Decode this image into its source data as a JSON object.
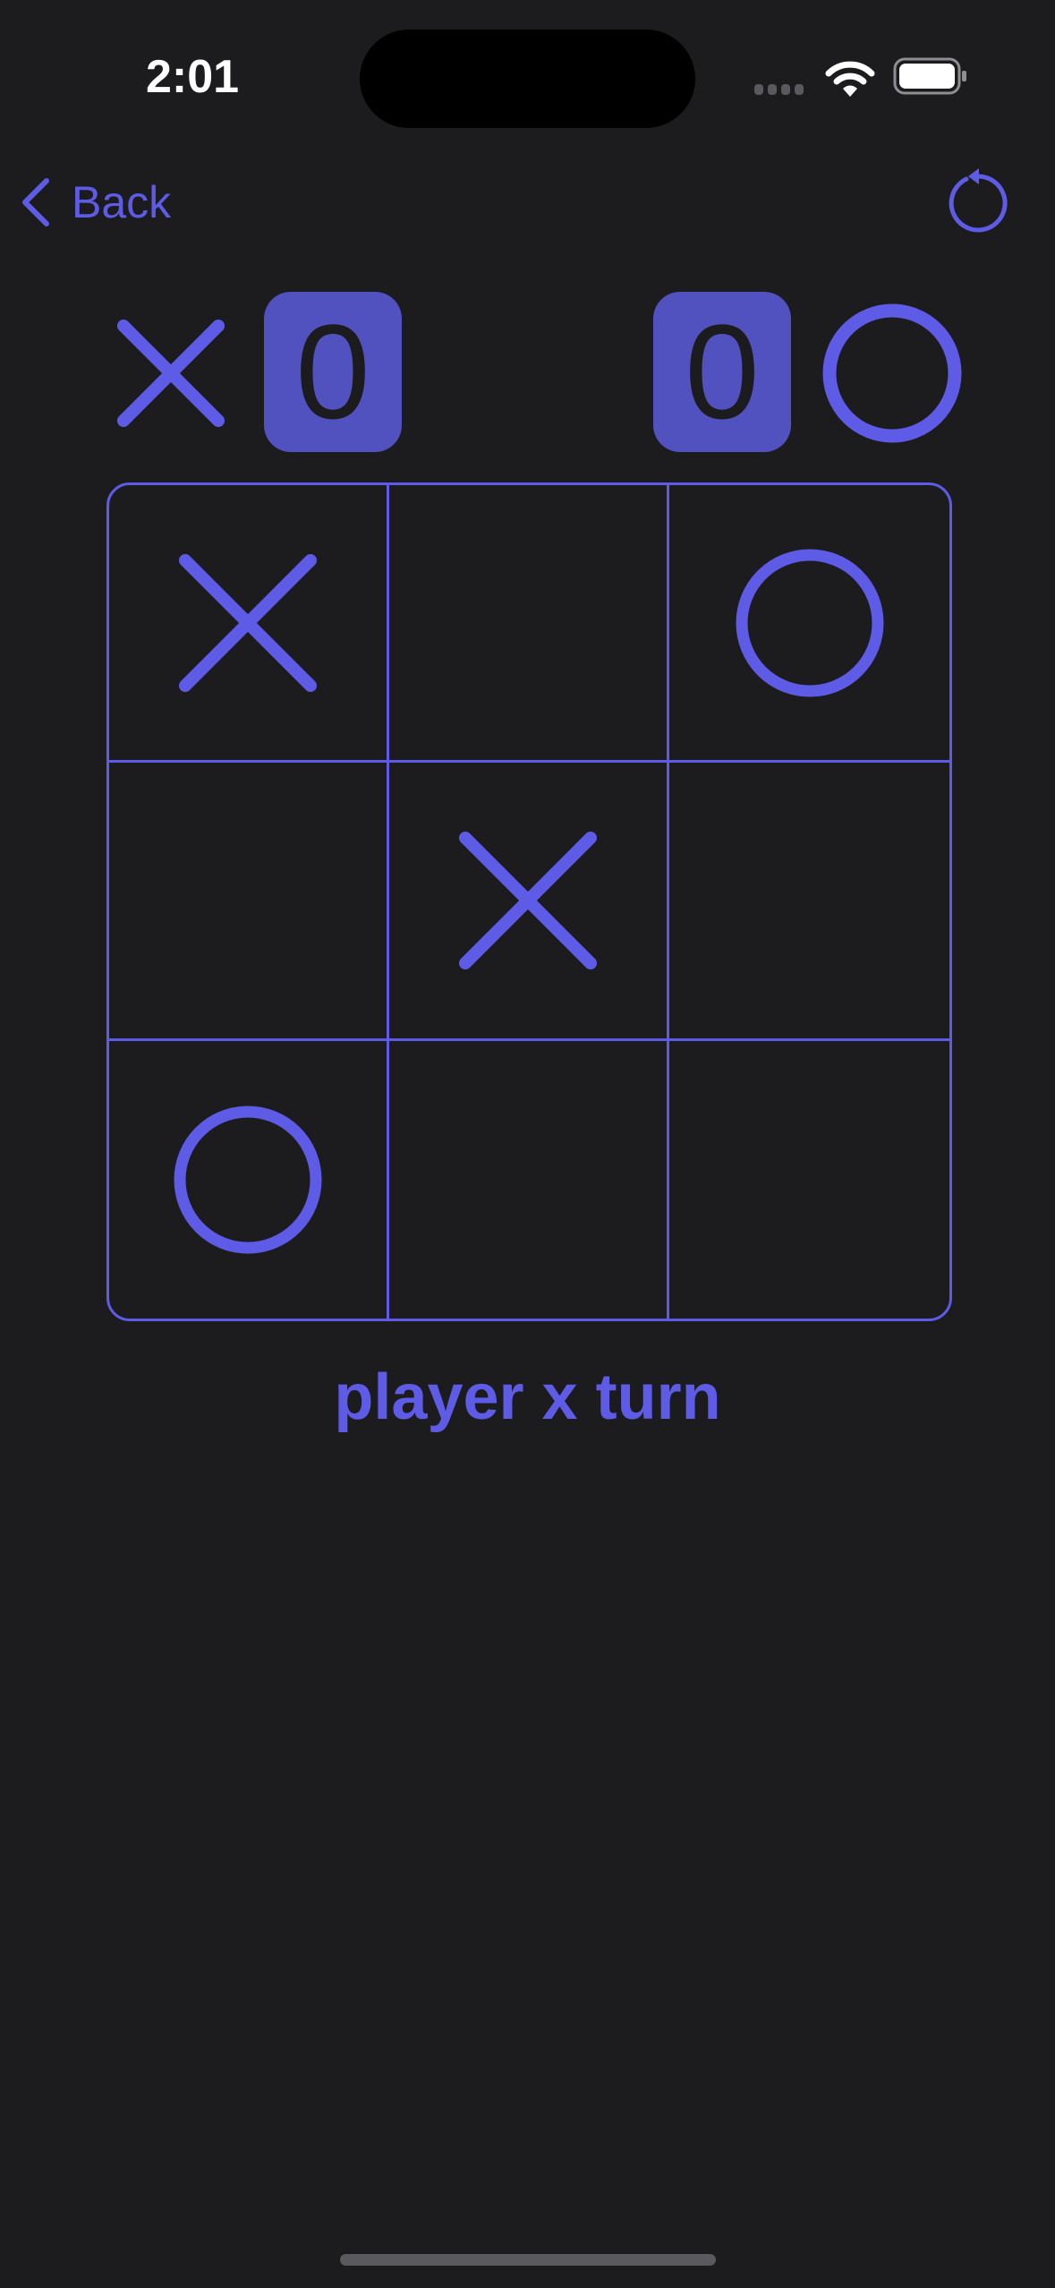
{
  "status_bar": {
    "time": "2:01",
    "signal_icon": "cellular-dots-icon",
    "wifi_icon": "wifi-icon",
    "battery_icon": "battery-full-icon"
  },
  "nav": {
    "back_label": "Back",
    "reset_icon": "arrow-counterclockwise-icon"
  },
  "scores": {
    "x": {
      "symbol": "X",
      "score": "0"
    },
    "o": {
      "symbol": "O",
      "score": "0"
    }
  },
  "board": {
    "cells": [
      "X",
      "",
      "O",
      "",
      "X",
      "",
      "O",
      "",
      ""
    ]
  },
  "status": "player x turn",
  "colors": {
    "accent": "#5e5ce6",
    "score_box": "#5152c0",
    "background": "#1c1c1e"
  }
}
